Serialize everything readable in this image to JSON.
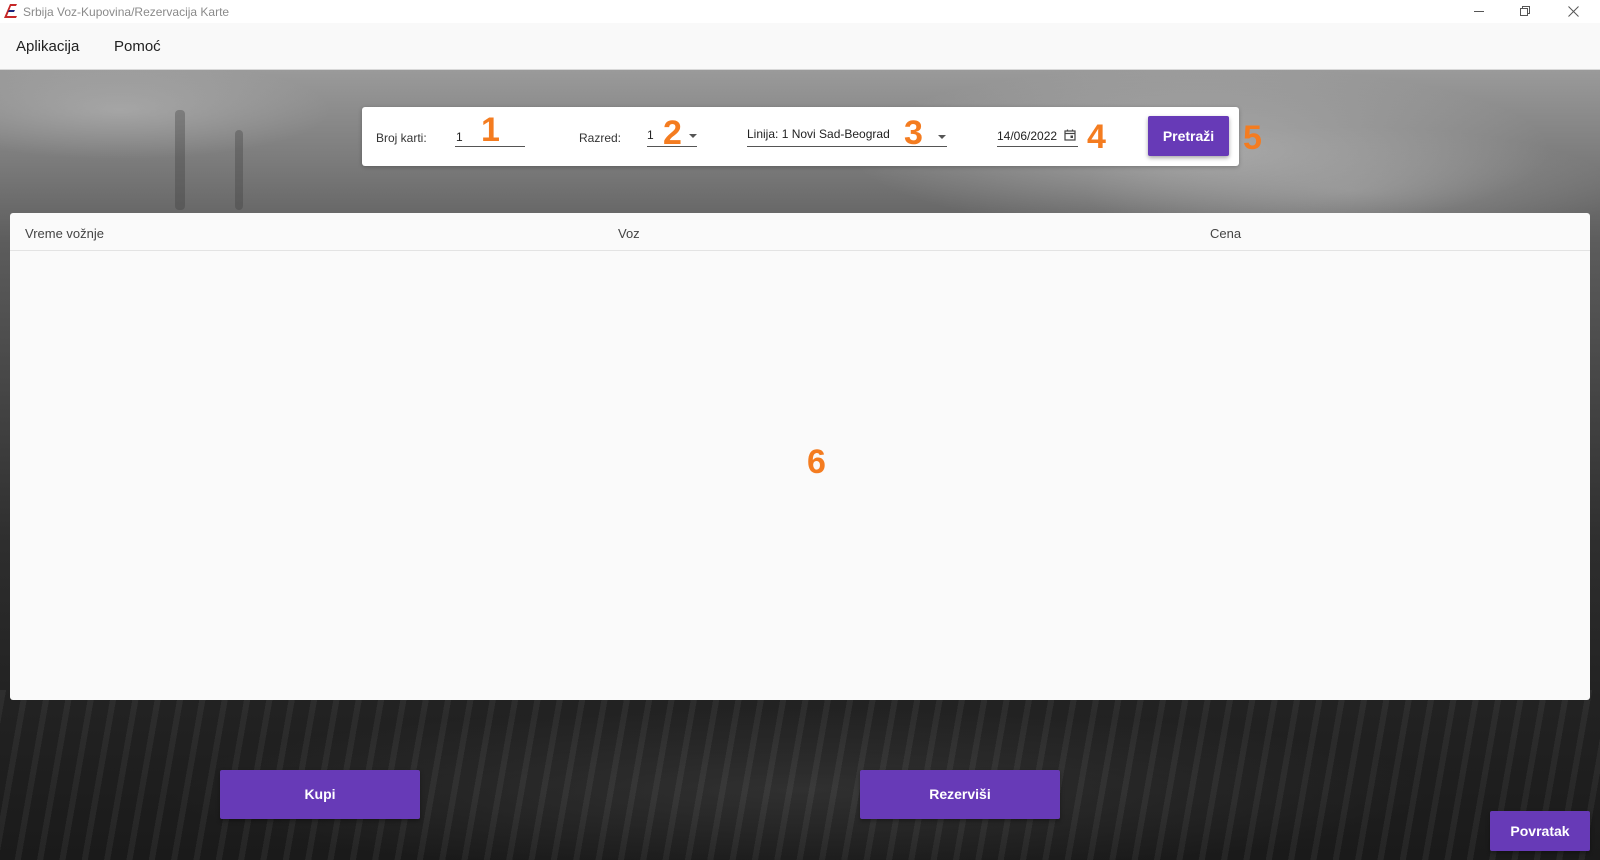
{
  "window": {
    "title": "Srbija Voz-Kupovina/Rezervacija Karte",
    "controls": [
      "minimize-icon",
      "restore-icon",
      "close-icon"
    ]
  },
  "menu": {
    "items": [
      {
        "label": "Aplikacija"
      },
      {
        "label": "Pomoć"
      }
    ]
  },
  "search": {
    "ticket_count_label": "Broj karti:",
    "ticket_count_value": "1",
    "class_label": "Razred:",
    "class_value": "1",
    "line_value": "Linija: 1 Novi Sad-Beograd",
    "date_value": "14/06/2022",
    "search_button": "Pretraži"
  },
  "markers": [
    "1",
    "2",
    "3",
    "4",
    "5",
    "6"
  ],
  "table": {
    "columns": [
      "Vreme vožnje",
      "Voz",
      "Cena"
    ],
    "rows": []
  },
  "actions": {
    "buy": "Kupi",
    "reserve": "Rezerviši",
    "back": "Povratak"
  },
  "colors": {
    "accent": "#673ab7",
    "marker": "#f47c20"
  }
}
